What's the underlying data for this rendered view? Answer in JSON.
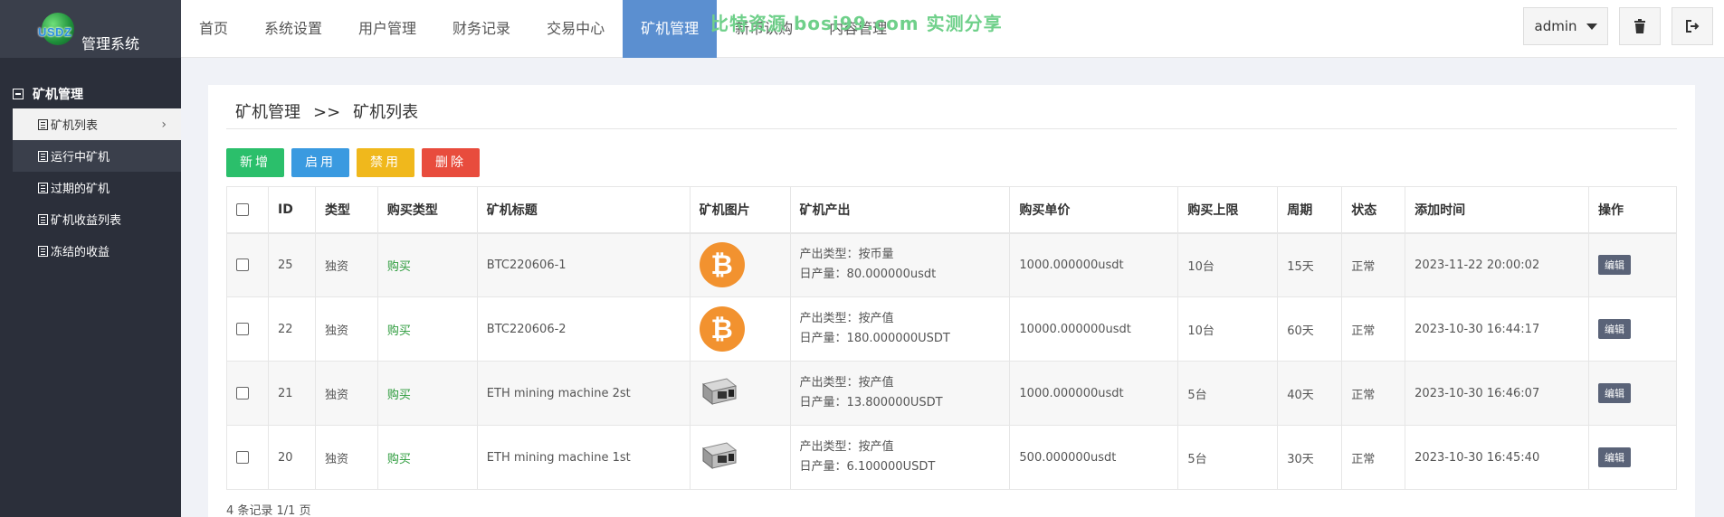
{
  "brand": {
    "logo_text": "USDZ",
    "title": "管理系统"
  },
  "nav": [
    "首页",
    "系统设置",
    "用户管理",
    "财务记录",
    "交易中心",
    "矿机管理",
    "新币认购",
    "内容管理"
  ],
  "watermark": "比特资源 bosi99.com 实测分享",
  "topbar": {
    "user": "admin"
  },
  "sidebar": {
    "section": "矿机管理",
    "items": [
      "矿机列表",
      "运行中矿机",
      "过期的矿机",
      "矿机收益列表",
      "冻结的收益"
    ]
  },
  "breadcrumb": {
    "parent": "矿机管理",
    "sep": ">>",
    "current": "矿机列表"
  },
  "buttons": {
    "add": "新增",
    "enable": "启用",
    "disable": "禁用",
    "delete": "删除"
  },
  "table": {
    "headers": [
      "",
      "ID",
      "类型",
      "购买类型",
      "矿机标题",
      "矿机图片",
      "矿机产出",
      "购买单价",
      "购买上限",
      "周期",
      "状态",
      "添加时间",
      "操作"
    ],
    "rows": [
      {
        "id": "25",
        "type": "独资",
        "buy_type": "购买",
        "title": "BTC220606-1",
        "image": "bitcoin-icon",
        "output_type": "产出类型：按币量",
        "output_daily": "日产量：80.000000usdt",
        "price": "1000.000000usdt",
        "limit": "10台",
        "cycle": "15天",
        "status": "正常",
        "time": "2023-11-22 20:00:02",
        "action": "编辑"
      },
      {
        "id": "22",
        "type": "独资",
        "buy_type": "购买",
        "title": "BTC220606-2",
        "image": "bitcoin-icon",
        "output_type": "产出类型：按产值",
        "output_daily": "日产量：180.000000USDT",
        "price": "10000.000000usdt",
        "limit": "10台",
        "cycle": "60天",
        "status": "正常",
        "time": "2023-10-30 16:44:17",
        "action": "编辑"
      },
      {
        "id": "21",
        "type": "独资",
        "buy_type": "购买",
        "title": "ETH mining machine 2st",
        "image": "miner-icon",
        "output_type": "产出类型：按产值",
        "output_daily": "日产量：13.800000USDT",
        "price": "1000.000000usdt",
        "limit": "5台",
        "cycle": "40天",
        "status": "正常",
        "time": "2023-10-30 16:46:07",
        "action": "编辑"
      },
      {
        "id": "20",
        "type": "独资",
        "buy_type": "购买",
        "title": "ETH mining machine 1st",
        "image": "miner-icon",
        "output_type": "产出类型：按产值",
        "output_daily": "日产量：6.100000USDT",
        "price": "500.000000usdt",
        "limit": "5台",
        "cycle": "30天",
        "status": "正常",
        "time": "2023-10-30 16:45:40",
        "action": "编辑"
      }
    ]
  },
  "pagination": "4 条记录 1/1 页",
  "colors": {
    "sidebar": "#2b2f3a",
    "nav_active": "#5b8fd0",
    "add": "#2bbf6b",
    "enable": "#3a9ae0",
    "disable": "#f0b81c",
    "delete": "#e84c3d",
    "bitcoin": "#f2922f"
  }
}
